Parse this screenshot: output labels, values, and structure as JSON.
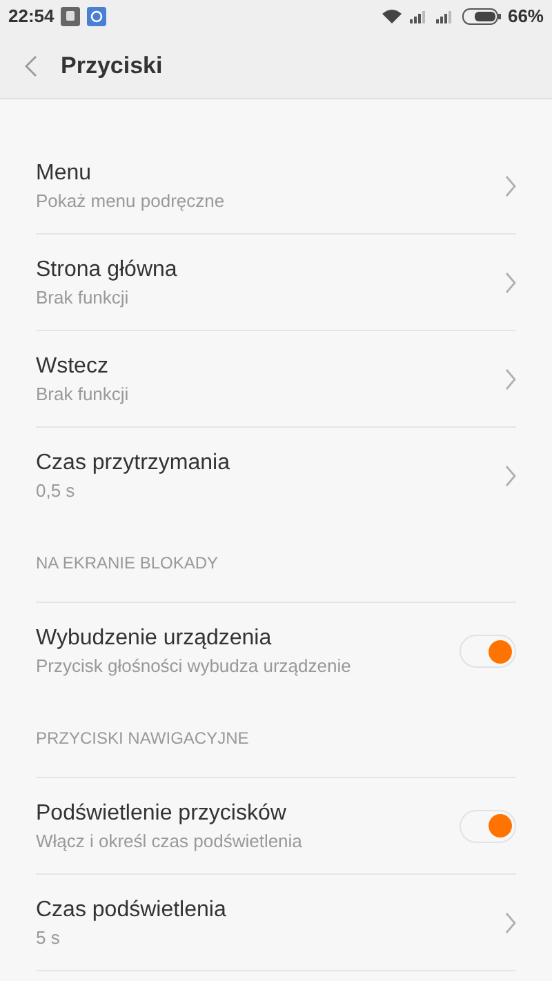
{
  "status_bar": {
    "time": "22:54",
    "battery": "66%"
  },
  "toolbar": {
    "title": "Przyciski"
  },
  "sections": [
    {
      "items": [
        {
          "kind": "link",
          "title": "Menu",
          "subtitle": "Pokaż menu podręczne"
        },
        {
          "kind": "link",
          "title": "Strona główna",
          "subtitle": "Brak funkcji"
        },
        {
          "kind": "link",
          "title": "Wstecz",
          "subtitle": "Brak funkcji"
        },
        {
          "kind": "link",
          "title": "Czas przytrzymania",
          "subtitle": "0,5 s"
        }
      ]
    },
    {
      "header": "NA EKRANIE BLOKADY",
      "items": [
        {
          "kind": "toggle",
          "title": "Wybudzenie urządzenia",
          "subtitle": "Przycisk głośności wybudza urządzenie",
          "on": true
        }
      ]
    },
    {
      "header": "PRZYCISKI NAWIGACYJNE",
      "items": [
        {
          "kind": "toggle",
          "title": "Podświetlenie przycisków",
          "subtitle": "Włącz i określ czas podświetlenia",
          "on": true
        },
        {
          "kind": "link",
          "title": "Czas podświetlenia",
          "subtitle": "5 s"
        }
      ]
    }
  ]
}
